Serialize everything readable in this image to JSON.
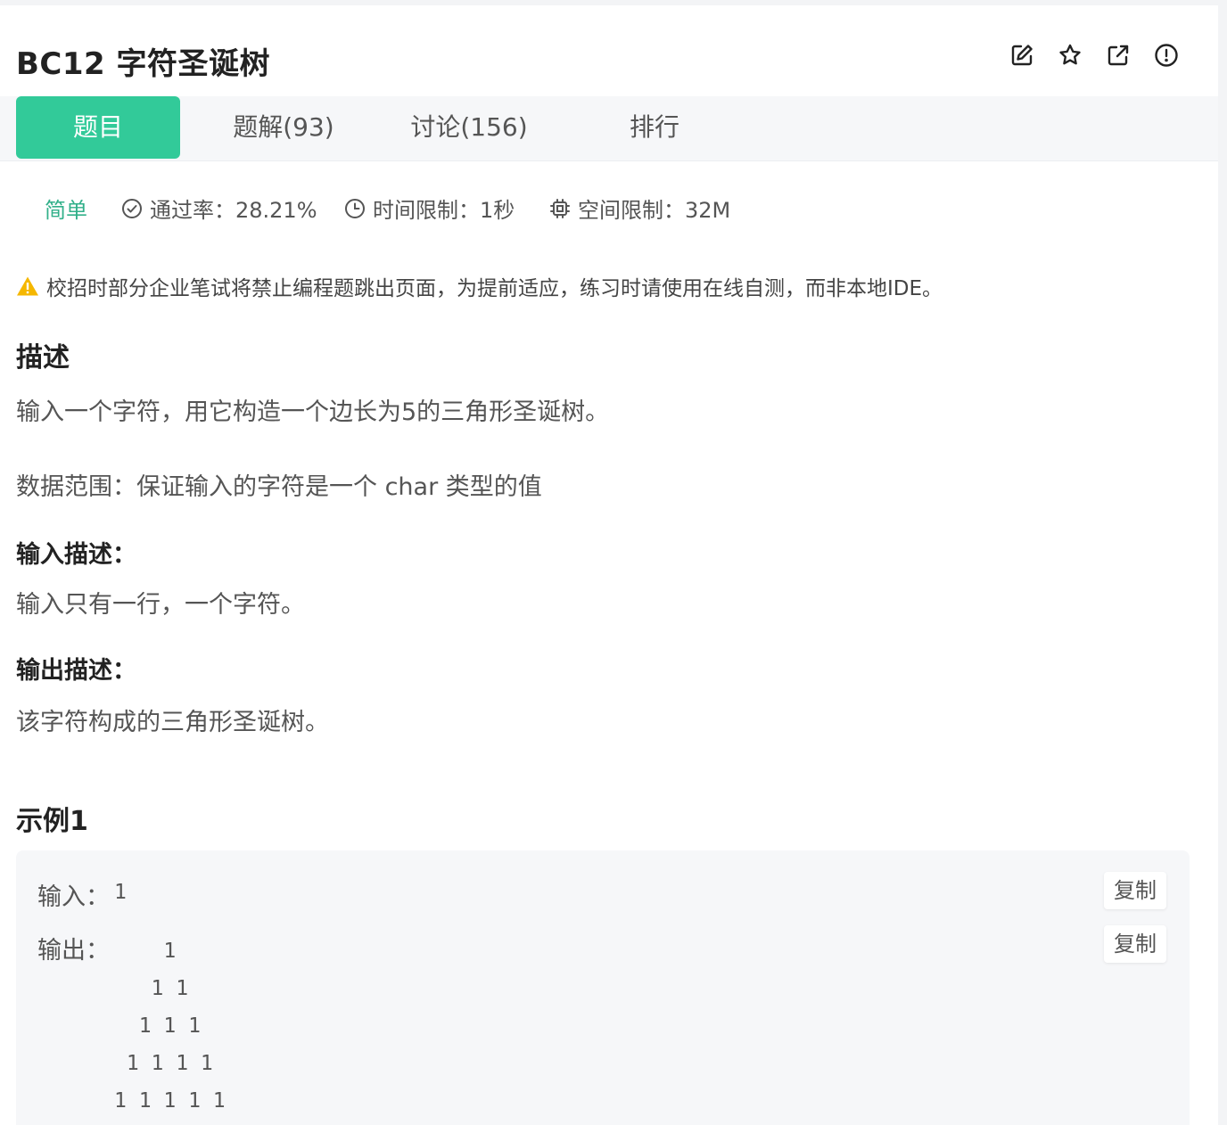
{
  "problem": {
    "title": "BC12  字符圣诞树"
  },
  "tabs": [
    {
      "label": "题目",
      "active": true
    },
    {
      "label": "题解(93)"
    },
    {
      "label": "讨论(156)"
    },
    {
      "label": "排行"
    }
  ],
  "meta": {
    "difficulty": "简单",
    "pass_rate": "通过率：28.21%",
    "time_limit": "时间限制：1秒",
    "space_limit": "空间限制：32M"
  },
  "warning": "校招时部分企业笔试将禁止编程题跳出页面，为提前适应，练习时请使用在线自测，而非本地IDE。",
  "description": {
    "heading": "描述",
    "text": "输入一个字符，用它构造一个边长为5的三角形圣诞树。",
    "range": "数据范围：保证输入的字符是一个 char 类型的值"
  },
  "input_desc": {
    "heading": "输入描述：",
    "text": "输入只有一行，一个字符。"
  },
  "output_desc": {
    "heading": "输出描述：",
    "text": "该字符构成的三角形圣诞树。"
  },
  "example": {
    "heading": "示例1",
    "input_label": "输入：",
    "input_value": "1",
    "output_label": "输出：",
    "output_value": "    1\n   1 1\n  1 1 1\n 1 1 1 1\n1 1 1 1 1",
    "copy_label": "复制"
  },
  "colors": {
    "accent": "#32ca99",
    "difficulty": "#32b08a",
    "warning": "#f5b700"
  },
  "icons": [
    "edit-icon",
    "star-icon",
    "external-link-icon",
    "report-icon",
    "check-circle-icon",
    "clock-icon",
    "chip-icon",
    "warning-icon"
  ]
}
